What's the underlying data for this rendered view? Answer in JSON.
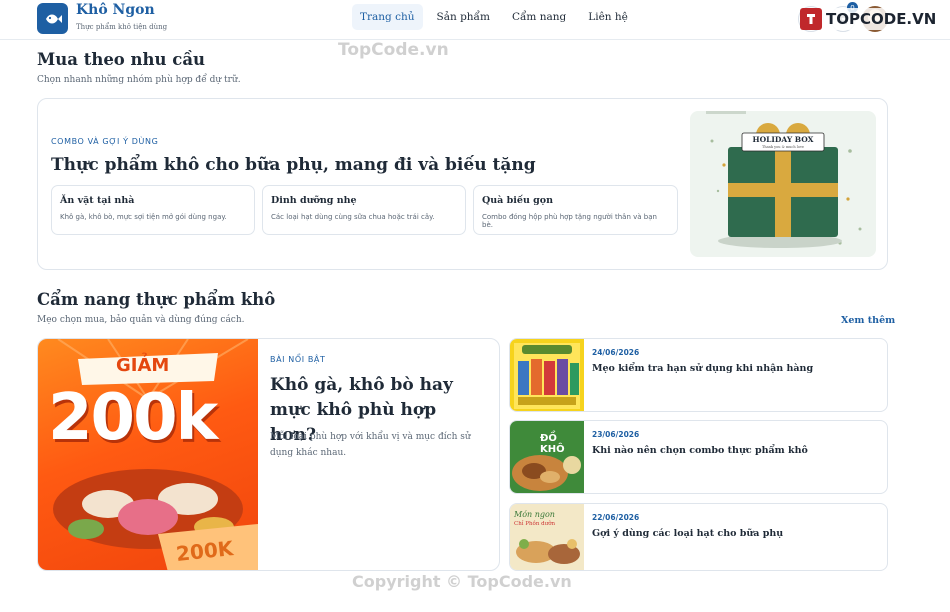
{
  "brand": {
    "name": "Khô Ngon",
    "tagline": "Thực phẩm khô tiện dùng"
  },
  "nav": {
    "items": [
      "Trang chủ",
      "Sản phẩm",
      "Cẩm nang",
      "Liên hệ"
    ],
    "active": "Trang chủ"
  },
  "header_icons": {
    "cart_count": "0"
  },
  "watermark": {
    "logo_text": "TOPCODE.VN",
    "top_text": "TopCode.vn",
    "bottom_text": "Copyright © TopCode.vn"
  },
  "needs": {
    "title": "Mua theo nhu cầu",
    "subtitle": "Chọn nhanh những nhóm phù hợp để dự trữ.",
    "eyebrow": "COMBO VÀ GỢI Ý DÙNG",
    "panel_title": "Thực phẩm khô cho bữa phụ, mang đi và biếu tặng",
    "cards": [
      {
        "title": "Ăn vặt tại nhà",
        "desc": "Khô gà, khô bò, mực sợi tiện mở gói dùng ngay."
      },
      {
        "title": "Dinh dưỡng nhẹ",
        "desc": "Các loại hạt dùng cùng sữa chua hoặc trái cây."
      },
      {
        "title": "Quà biếu gọn",
        "desc": "Combo đóng hộp phù hợp tặng người thân và bạn bè."
      }
    ],
    "gift_label": "HOLIDAY BOX",
    "gift_sublabel": "Thank you & much love"
  },
  "guide": {
    "title": "Cẩm nang thực phẩm khô",
    "subtitle": "Mẹo chọn mua, bảo quản và dùng đúng cách.",
    "see_more": "Xem thêm",
    "featured": {
      "eyebrow": "BÀI NỔI BẬT",
      "title": "Khô gà, khô bò hay mực khô phù hợp hơn?",
      "desc": "Mỗi loại phù hợp với khẩu vị và mục đích sử dụng khác nhau.",
      "promo_top": "GIẢM",
      "promo_big": "200k",
      "promo_ticket": "200K"
    },
    "posts": [
      {
        "date": "24/06/2026",
        "title": "Mẹo kiểm tra hạn sử dụng khi nhận hàng",
        "thumb_text": ""
      },
      {
        "date": "23/06/2026",
        "title": "Khi nào nên chọn combo thực phẩm khô",
        "thumb_text": "ĐỒ KHÔ"
      },
      {
        "date": "22/06/2026",
        "title": "Gợi ý dùng các loại hạt cho bữa phụ",
        "thumb_text": "Chỉ Phồn dưỡn"
      }
    ]
  }
}
